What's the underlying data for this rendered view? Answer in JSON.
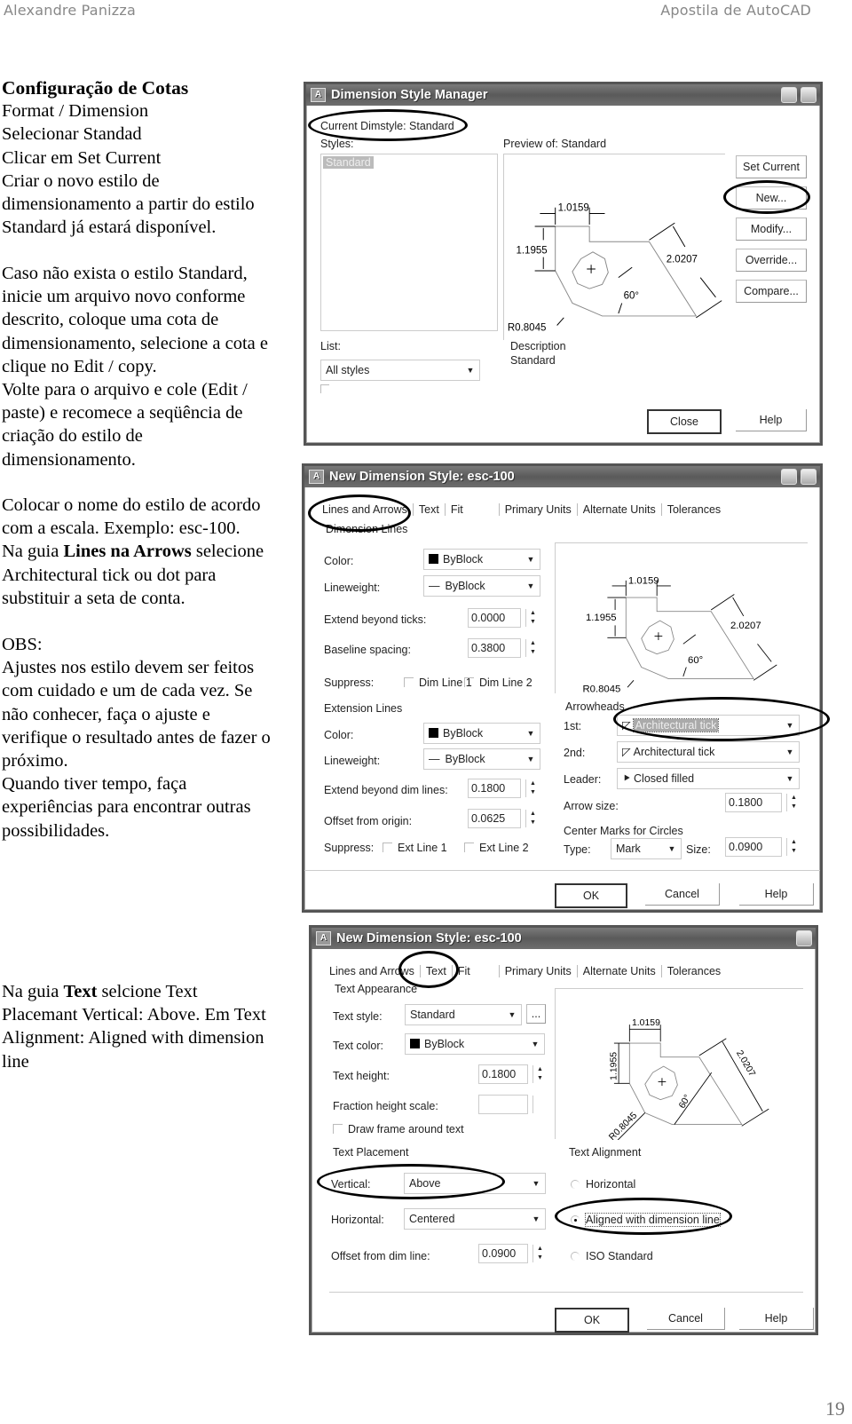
{
  "header": {
    "author": "Alexandre Panizza",
    "doc_title": "Apostila de AutoCAD"
  },
  "page_number": "19",
  "text": {
    "heading": "Configuração de Cotas",
    "block1": [
      "Format / Dimension",
      "Selecionar Standad",
      "Clicar em Set Current",
      "Criar o novo estilo de",
      "dimensionamento a partir do estilo",
      "Standard já estará disponível."
    ],
    "block2": [
      "Caso não exista o estilo Standard,",
      "inicie um arquivo novo conforme",
      "descrito, coloque uma cota de",
      "dimensionamento, selecione a cota e",
      "clique no Edit / copy.",
      "Volte para o arquivo e cole (Edit /",
      "paste) e recomece a seqüência de",
      "criação do estilo de",
      "dimensionamento."
    ],
    "block3_line1": "Colocar o nome do estilo de acordo",
    "block3_line2": "com a escala. Exemplo: esc-100.",
    "block3_pre": "Na guia ",
    "block3_bold": "Lines na Arrows",
    "block3_post": " selecione",
    "block3_line4": "Architectural tick ou dot para",
    "block3_line5": "substituir a seta de conta.",
    "obs_title": "OBS:",
    "obs": [
      "Ajustes nos estilo devem ser feitos",
      "com cuidado e um de cada vez. Se",
      "não conhecer, faça o ajuste e",
      "verifique o resultado antes de fazer o",
      "próximo.",
      "Quando tiver tempo, faça",
      "experiências para encontrar outras",
      "possibilidades."
    ],
    "block4_pre": "Na guia ",
    "block4_bold": "Text",
    "block4_post": " selcione Text",
    "block4_rest": [
      "Placemant Vertical: Above. Em Text",
      "Alignment: Aligned with dimension",
      "line"
    ]
  },
  "preview": {
    "d1": "1.0159",
    "d2": "1.1955",
    "d3": "2.0207",
    "angle": "60°",
    "radius": "R0.8045"
  },
  "dlg1": {
    "title": "Dimension Style Manager",
    "current": "Current Dimstyle: Standard",
    "styles_label": "Styles:",
    "styles": [
      "Standard"
    ],
    "preview_label": "Preview of: Standard",
    "buttons": [
      "Set Current",
      "New...",
      "Modify...",
      "Override...",
      "Compare..."
    ],
    "list_label": "List:",
    "list_value": "All styles",
    "desc_label": "Description",
    "desc_value": "Standard",
    "close": "Close",
    "help": "Help"
  },
  "dlg2": {
    "title": "New Dimension Style: esc-100",
    "tabs": [
      "Lines and Arrows",
      "Text",
      "Fit",
      "Primary Units",
      "Alternate Units",
      "Tolerances"
    ],
    "dim_lines": "Dimension Lines",
    "color_label": "Color:",
    "color_value": "ByBlock",
    "lw_label": "Lineweight:",
    "lw_value": "ByBlock",
    "ext_ticks_label": "Extend beyond ticks:",
    "ext_ticks_value": "0.0000",
    "baseline_label": "Baseline spacing:",
    "baseline_value": "0.3800",
    "suppress_label": "Suppress:",
    "dim1": "Dim Line 1",
    "dim2": "Dim Line 2",
    "ext_lines": "Extension Lines",
    "ecolor_label": "Color:",
    "ecolor_value": "ByBlock",
    "elw_label": "Lineweight:",
    "elw_value": "ByBlock",
    "ext_dim_label": "Extend beyond dim lines:",
    "ext_dim_value": "0.1800",
    "offset_label": "Offset from origin:",
    "offset_value": "0.0625",
    "esuppress_label": "Suppress:",
    "ext1": "Ext Line 1",
    "ext2": "Ext Line 2",
    "arrowheads": "Arrowheads",
    "first_label": "1st:",
    "first_value": "Architectural tick",
    "second_label": "2nd:",
    "second_value": "Architectural tick",
    "leader_label": "Leader:",
    "leader_value": "Closed filled",
    "arrow_size_label": "Arrow size:",
    "arrow_size_value": "0.1800",
    "center_marks": "Center Marks for Circles",
    "type_label": "Type:",
    "type_value": "Mark",
    "size_label": "Size:",
    "size_value": "0.0900",
    "ok": "OK",
    "cancel": "Cancel",
    "help": "Help"
  },
  "dlg3": {
    "title": "New Dimension Style: esc-100",
    "tabs": [
      "Lines and Arrows",
      "Text",
      "Fit",
      "Primary Units",
      "Alternate Units",
      "Tolerances"
    ],
    "appearance": "Text Appearance",
    "style_label": "Text style:",
    "style_value": "Standard",
    "style_btn": "...",
    "color_label": "Text color:",
    "color_value": "ByBlock",
    "height_label": "Text height:",
    "height_value": "0.1800",
    "fraction_label": "Fraction height scale:",
    "frame_label": "Draw frame around text",
    "placement": "Text Placement",
    "vertical_label": "Vertical:",
    "vertical_value": "Above",
    "horizontal_label": "Horizontal:",
    "horizontal_value": "Centered",
    "offset_label": "Offset from dim line:",
    "offset_value": "0.0900",
    "alignment": "Text Alignment",
    "align_options": [
      "Horizontal",
      "Aligned with dimension line",
      "ISO Standard"
    ],
    "ok": "OK",
    "cancel": "Cancel",
    "help": "Help"
  }
}
